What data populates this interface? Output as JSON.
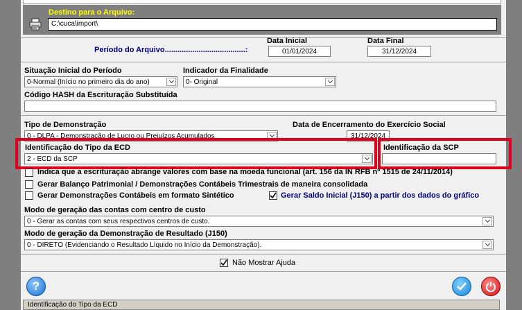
{
  "destino": {
    "label": "Destino para o Arquivo:",
    "value": "C:\\cuca\\import\\"
  },
  "periodo": {
    "label": "Período do Arquivo......................................:",
    "inicial_label": "Data Inicial",
    "inicial_value": "01/01/2024",
    "final_label": "Data Final",
    "final_value": "31/12/2024"
  },
  "situacao": {
    "label": "Situação Inicial do Período",
    "value": "0-Normal (Início no primeiro dia do ano)"
  },
  "finalidade": {
    "label": "Indicador da Finalidade",
    "value": "0- Original"
  },
  "hash": {
    "label": "Código HASH da Escrituração Substituída",
    "value": ""
  },
  "demonstracao": {
    "label": "Tipo de Demonstração",
    "value": "0 - DLPA - Demonstração de Lucro ou Prejuízos Acumulados"
  },
  "encerramento": {
    "label": "Data de Encerramento do Exercício Social",
    "value": "31/12/2024"
  },
  "tipo_ecd": {
    "label": "Identificação do Tipo da ECD",
    "value": "2 - ECD da SCP"
  },
  "scp": {
    "label": "Identificação da SCP",
    "value": ""
  },
  "checks": {
    "moeda": "Indica que a escrituração abrange valores com base na moeda funcional (art. 156 da IN RFB nº 1515 de 24/11/2014)",
    "balanco": "Gerar Balanço Patrimonial / Demonstrações Contábeis Trimestrais de maneira consolidada",
    "sintetico": "Gerar Demonstrações Contábeis em formato Sintético",
    "saldo": "Gerar Saldo Inicial (J150) a partir dos dados do gráfico"
  },
  "modo_contas": {
    "label": "Modo de geração das contas com centro de custo",
    "value": "0 - Gerar as contas com seus respectivos centros de custo."
  },
  "modo_dre": {
    "label": "Modo de geração da Demonstração de Resultado (J150)",
    "value": "0 - DIRETO (Evidenciando o Resultado Líquido no Início da Demonstração)."
  },
  "ajuda": {
    "label": "Não Mostrar Ajuda"
  },
  "status": {
    "text": "Identificação do Tipo da ECD"
  },
  "colors": {
    "accent_red": "#e0001b",
    "label_blue": "#000080",
    "dest_yellow": "#ffff00"
  }
}
